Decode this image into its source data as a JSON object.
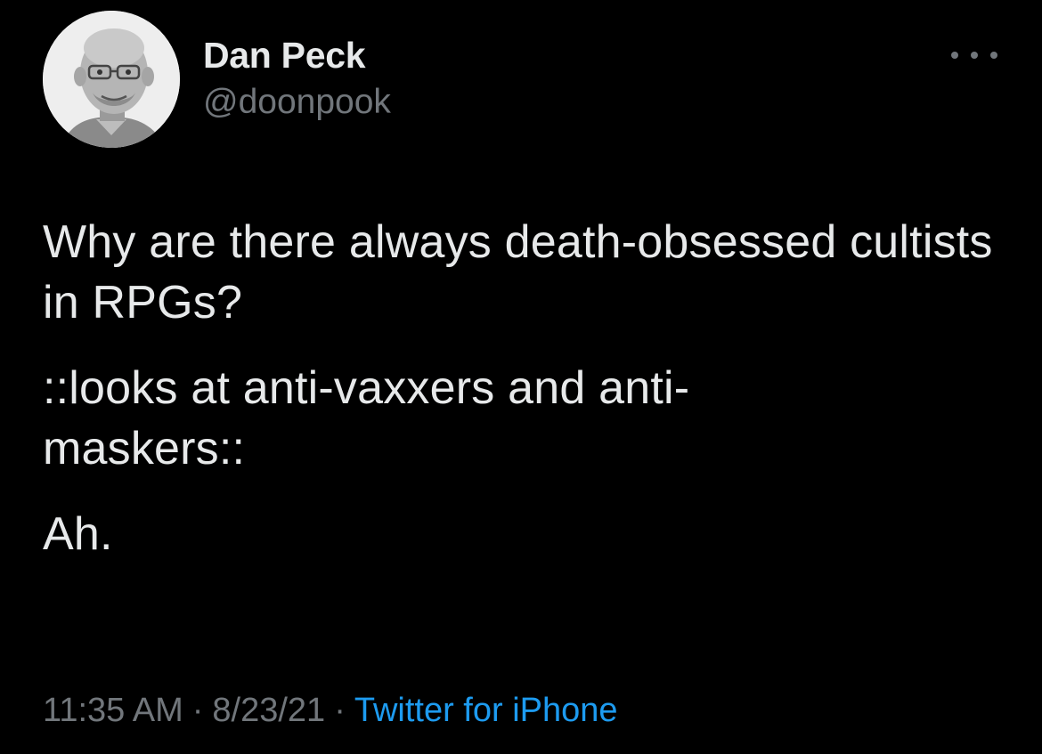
{
  "author": {
    "name": "Dan Peck",
    "handle": "@doonpook",
    "avatar_icon": "profile-photo"
  },
  "tweet": {
    "paragraphs": [
      "Why are there always death-obsessed cultists in RPGs?",
      "::looks at anti-vaxxers and anti-maskers::",
      "Ah."
    ],
    "time": "11:35 AM",
    "separator": "·",
    "date": "8/23/21",
    "source": "Twitter for iPhone"
  },
  "icons": {
    "more": "more-horizontal-icon"
  },
  "colors": {
    "background": "#000000",
    "text": "#e7e9ea",
    "secondary": "#71767b",
    "link": "#1d9bf0"
  }
}
